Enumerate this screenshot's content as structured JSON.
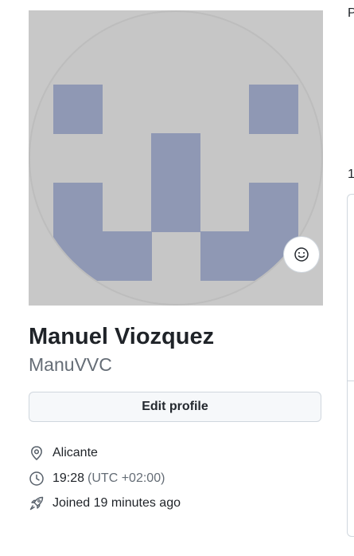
{
  "profile": {
    "full_name": "Manuel Viozquez",
    "username": "ManuVVC",
    "edit_button_label": "Edit profile",
    "avatar_icon": "identicon",
    "status_icon": "smiley-icon"
  },
  "details": {
    "location": "Alicante",
    "local_time": "19:28",
    "timezone": "(UTC +02:00)",
    "joined": "Joined 19 minutes ago"
  },
  "right_column": {
    "heading_fragment": "P",
    "count_fragment": "1"
  },
  "colors": {
    "avatar_bg": "#c8c8c8",
    "identicon_fill": "#8f98b4",
    "button_bg": "#f6f8fa",
    "border": "#d0d7de",
    "muted_text": "#656d76"
  }
}
